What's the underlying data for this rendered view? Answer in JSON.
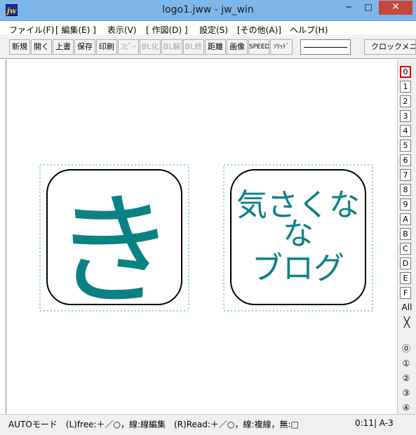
{
  "window": {
    "title": "logo1.jww - jw_win",
    "icon_label": "jw",
    "min_glyph": "─",
    "max_glyph": "□",
    "close_glyph": "✕"
  },
  "menu": [
    "ファイル(F)",
    "[ 編集(E) ]",
    "表示(V)",
    "[ 作図(D) ]",
    "設定(S)",
    "[その他(A)]",
    "ヘルプ(H)"
  ],
  "toolbar": {
    "buttons": [
      "新規",
      "開く",
      "上書",
      "保存",
      "印刷",
      "ｺﾋﾟｰ",
      "BL化",
      "BL解",
      "BL終",
      "距離",
      "画像",
      "SPEED",
      "ｿﾘｯﾄﾞ"
    ],
    "clock_label": "クロックメニ"
  },
  "logos": {
    "left": {
      "glyph": "き"
    },
    "right": {
      "lines": [
        "気さくな",
        "な",
        "ブログ"
      ]
    }
  },
  "colors": {
    "text_teal": "#0a8284",
    "frame": "#000000",
    "dotted": "#2aa6a8",
    "active_layer": "#e00000"
  },
  "layers": [
    "0",
    "1",
    "2",
    "3",
    "4",
    "5",
    "6",
    "7",
    "8",
    "9",
    "A",
    "B",
    "C",
    "D",
    "E",
    "F"
  ],
  "layer_all": "All",
  "layer_cross": "╳",
  "groups": [
    "⓪",
    "①",
    "②",
    "③",
    "④"
  ],
  "status": {
    "text": "AUTOモード　(L)free:＋／○，線:線編集　(R)Read:＋／○，線:複線，無:□",
    "scale": "0:11| A-3"
  }
}
